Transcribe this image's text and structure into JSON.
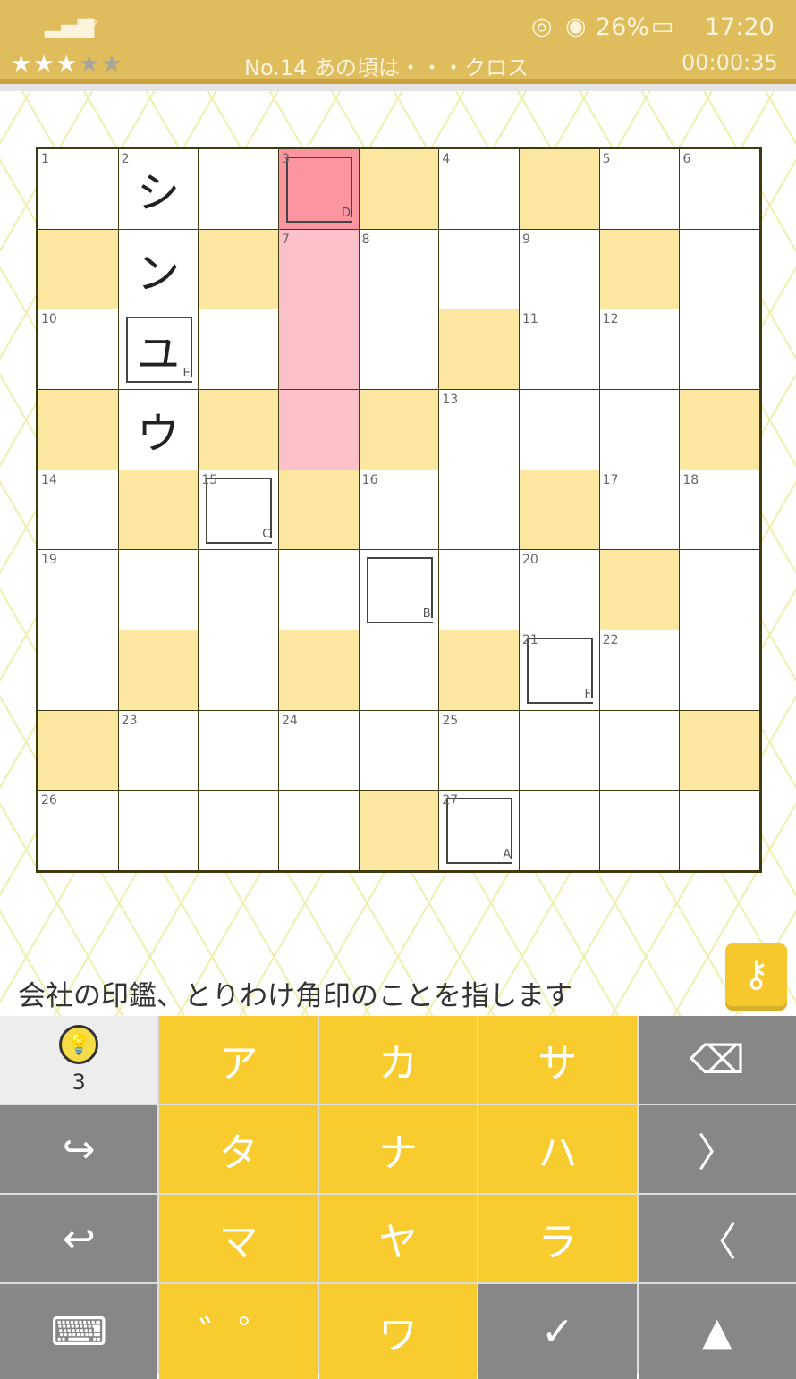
{
  "status": {
    "time": "17:20",
    "battery": "26%"
  },
  "header": {
    "title": "No.14 あの頃は・・・クロス",
    "timer": "00:00:35",
    "rating": 3,
    "rating_max": 5
  },
  "grid": {
    "rows": [
      [
        {
          "t": "w",
          "n": "1"
        },
        {
          "t": "w",
          "n": "2",
          "ch": "シ"
        },
        {
          "t": "w"
        },
        {
          "t": "r",
          "n": "3",
          "box": "D"
        },
        {
          "t": "b"
        },
        {
          "t": "w",
          "n": "4"
        },
        {
          "t": "b"
        },
        {
          "t": "w",
          "n": "5"
        },
        {
          "t": "w",
          "n": "6"
        }
      ],
      [
        {
          "t": "b"
        },
        {
          "t": "w",
          "ch": "ン"
        },
        {
          "t": "b"
        },
        {
          "t": "p",
          "n": "7"
        },
        {
          "t": "w",
          "n": "8"
        },
        {
          "t": "w"
        },
        {
          "t": "w",
          "n": "9"
        },
        {
          "t": "b"
        },
        {
          "t": "w"
        }
      ],
      [
        {
          "t": "w",
          "n": "10"
        },
        {
          "t": "w",
          "ch": "ユ",
          "box": "E"
        },
        {
          "t": "w"
        },
        {
          "t": "p"
        },
        {
          "t": "w"
        },
        {
          "t": "b"
        },
        {
          "t": "w",
          "n": "11"
        },
        {
          "t": "w",
          "n": "12"
        },
        {
          "t": "w"
        }
      ],
      [
        {
          "t": "b"
        },
        {
          "t": "w",
          "ch": "ウ"
        },
        {
          "t": "b"
        },
        {
          "t": "p"
        },
        {
          "t": "b"
        },
        {
          "t": "w",
          "n": "13"
        },
        {
          "t": "w"
        },
        {
          "t": "w"
        },
        {
          "t": "b"
        }
      ],
      [
        {
          "t": "w",
          "n": "14"
        },
        {
          "t": "b"
        },
        {
          "t": "w",
          "n": "15",
          "box": "C"
        },
        {
          "t": "b"
        },
        {
          "t": "w",
          "n": "16"
        },
        {
          "t": "w"
        },
        {
          "t": "b"
        },
        {
          "t": "w",
          "n": "17"
        },
        {
          "t": "w",
          "n": "18"
        }
      ],
      [
        {
          "t": "w",
          "n": "19"
        },
        {
          "t": "w"
        },
        {
          "t": "w"
        },
        {
          "t": "w"
        },
        {
          "t": "w",
          "box": "B"
        },
        {
          "t": "w"
        },
        {
          "t": "w",
          "n": "20"
        },
        {
          "t": "b"
        },
        {
          "t": "w"
        }
      ],
      [
        {
          "t": "w"
        },
        {
          "t": "b"
        },
        {
          "t": "w"
        },
        {
          "t": "b"
        },
        {
          "t": "w"
        },
        {
          "t": "b"
        },
        {
          "t": "w",
          "n": "21",
          "box": "F"
        },
        {
          "t": "w",
          "n": "22"
        },
        {
          "t": "w"
        }
      ],
      [
        {
          "t": "b"
        },
        {
          "t": "w",
          "n": "23"
        },
        {
          "t": "w"
        },
        {
          "t": "w",
          "n": "24"
        },
        {
          "t": "w"
        },
        {
          "t": "w",
          "n": "25"
        },
        {
          "t": "w"
        },
        {
          "t": "w"
        },
        {
          "t": "b"
        }
      ],
      [
        {
          "t": "w",
          "n": "26"
        },
        {
          "t": "w"
        },
        {
          "t": "w"
        },
        {
          "t": "w"
        },
        {
          "t": "b"
        },
        {
          "t": "w",
          "n": "27",
          "box": "A"
        },
        {
          "t": "w"
        },
        {
          "t": "w"
        },
        {
          "t": "w"
        }
      ]
    ]
  },
  "clue": "会社の印鑑、とりわけ角印のことを指します",
  "hint": {
    "count": "3"
  },
  "keyboard": [
    {
      "k": "hint",
      "name": "hint-button"
    },
    {
      "k": "ア",
      "c": "y"
    },
    {
      "k": "カ",
      "c": "y"
    },
    {
      "k": "サ",
      "c": "y"
    },
    {
      "k": "⌫",
      "c": "g",
      "name": "backspace-button"
    },
    {
      "k": "↪",
      "c": "g",
      "name": "redo-button"
    },
    {
      "k": "タ",
      "c": "y"
    },
    {
      "k": "ナ",
      "c": "y"
    },
    {
      "k": "ハ",
      "c": "y"
    },
    {
      "k": "〉",
      "c": "g",
      "name": "next-button"
    },
    {
      "k": "↩",
      "c": "g",
      "name": "undo-button"
    },
    {
      "k": "マ",
      "c": "y"
    },
    {
      "k": "ヤ",
      "c": "y"
    },
    {
      "k": "ラ",
      "c": "y"
    },
    {
      "k": "〈",
      "c": "g",
      "name": "prev-button"
    },
    {
      "k": "⌨",
      "c": "g",
      "name": "keyboard-toggle-button"
    },
    {
      "k": "゛゜",
      "c": "y",
      "name": "dakuten-button"
    },
    {
      "k": "ワ",
      "c": "y"
    },
    {
      "k": "✓",
      "c": "g",
      "name": "confirm-button"
    },
    {
      "k": "▲",
      "c": "g",
      "name": "up-button"
    }
  ]
}
